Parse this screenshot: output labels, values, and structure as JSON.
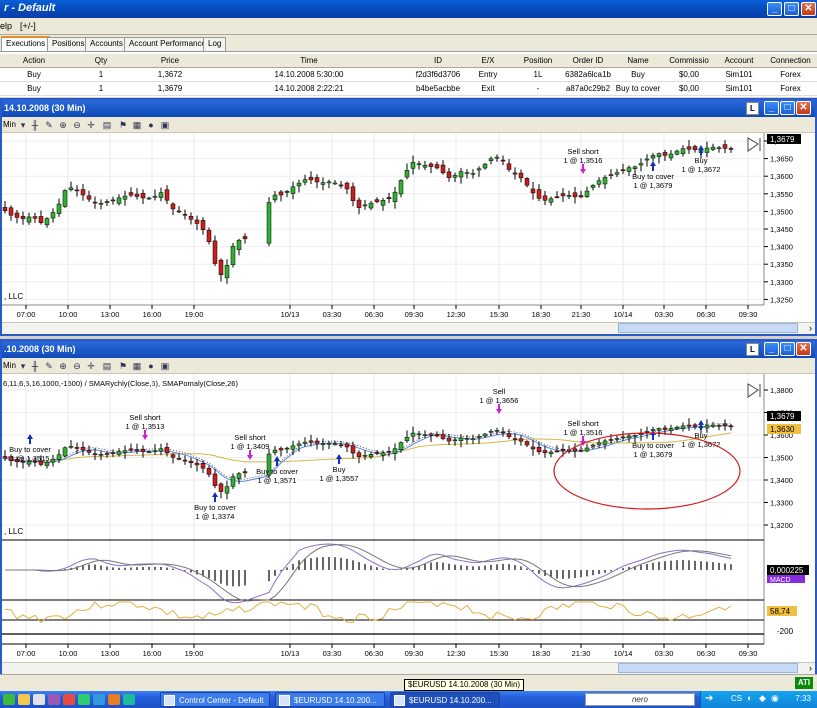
{
  "window": {
    "title": "r - Default"
  },
  "menu": {
    "help": "elp",
    "plusminus": "[+/-]"
  },
  "tabs": [
    "Executions",
    "Positions",
    "Accounts",
    "Account Performance",
    "Log"
  ],
  "executions": {
    "columns": [
      "Action",
      "Qty",
      "Price",
      "Time",
      "ID",
      "E/X",
      "Position",
      "Order ID",
      "Name",
      "Commissio",
      "Account",
      "Connection"
    ],
    "rows": [
      [
        "Buy",
        "1",
        "1,3672",
        "14.10.2008 5:30:00",
        "f2d3f6d3706",
        "Entry",
        "1L",
        "6382a6lca1b",
        "Buy",
        "$0,00",
        "Sim101",
        "Forex"
      ],
      [
        "Buy",
        "1",
        "1,3679",
        "14.10.2008 2:22:21",
        "b4be5acbbe",
        "Exit",
        "-",
        "a87a0c29b2",
        "Buy to cover",
        "$0,00",
        "Sim101",
        "Forex"
      ]
    ]
  },
  "chart1": {
    "title": "14.10.2008 (30 Min)",
    "interval": "Min",
    "copyright": ", LLC",
    "last_price": "1,3679",
    "x_ticks": [
      "07:00",
      "10:00",
      "13:00",
      "16:00",
      "19:00",
      "10/13",
      "03:30",
      "06:30",
      "09:30",
      "12:30",
      "15:30",
      "18:30",
      "21:30",
      "10/14",
      "03:30",
      "06:30",
      "09:30"
    ],
    "y_ticks": [
      "1,3700",
      "1,3650",
      "1,3600",
      "1,3550",
      "1,3500",
      "1,3450",
      "1,3400",
      "1,3350",
      "1,3300",
      "1,3250"
    ],
    "annotations": [
      {
        "l1": "Sell short",
        "l2": "1 @ 1,3516"
      },
      {
        "l1": "Buy to cover",
        "l2": "1 @ 1,3679"
      },
      {
        "l1": "Buy",
        "l2": "1 @ 1,3672"
      }
    ]
  },
  "chart2": {
    "title": ".10.2008 (30 Min)",
    "interval": "Min",
    "indicator_label": "6,11,6,5,16,1000,-1600) / SMARychly(Close,6), SMAPomaly(Close,26)",
    "copyright": ", LLC",
    "last_price": "1,3679",
    "sma_value": "1,3630",
    "osc_value": "0,000225",
    "osc_label": "MACD",
    "cci_value": "58,74",
    "cci_bottom": "-200",
    "x_ticks": [
      "07:00",
      "10:00",
      "13:00",
      "16:00",
      "19:00",
      "10/13",
      "03:30",
      "06:30",
      "09:30",
      "12:30",
      "15:30",
      "18:30",
      "21:30",
      "10/14",
      "03:30",
      "06:30",
      "09:30"
    ],
    "y_ticks": [
      "1,3800",
      "1,3700",
      "1,3600",
      "1,3500",
      "1,3400",
      "1,3300",
      "1,3200"
    ],
    "annotations": [
      {
        "l1": "Buy to cover",
        "l2": "1 @ 1,3515"
      },
      {
        "l1": "Sell short",
        "l2": "1 @ 1,3513"
      },
      {
        "l1": "Buy to cover",
        "l2": "1 @ 1,3374"
      },
      {
        "l1": "Sell short",
        "l2": "1 @ 1,3409"
      },
      {
        "l1": "Buy to cover",
        "l2": "1 @ 1,3571"
      },
      {
        "l1": "Buy",
        "l2": "1 @ 1,3557"
      },
      {
        "l1": "Sell",
        "l2": "1 @ 1,3656"
      },
      {
        "l1": "Sell short",
        "l2": "1 @ 1,3516"
      },
      {
        "l1": "Buy to cover",
        "l2": "1 @ 1,3679"
      },
      {
        "l1": "Buy",
        "l2": "1 @ 1,3672"
      }
    ]
  },
  "tooltip": "$EURUSD 14.10.2008 (30 Min)",
  "statusbar": {
    "badge": "ATI"
  },
  "taskbar": {
    "items": [
      "Control Center - Default",
      "$EURUSD 14.10.200...",
      "$EURUSD 14.10.200..."
    ],
    "tray_label": "nero",
    "tray_lang": "CS",
    "clock": "7:33"
  }
}
